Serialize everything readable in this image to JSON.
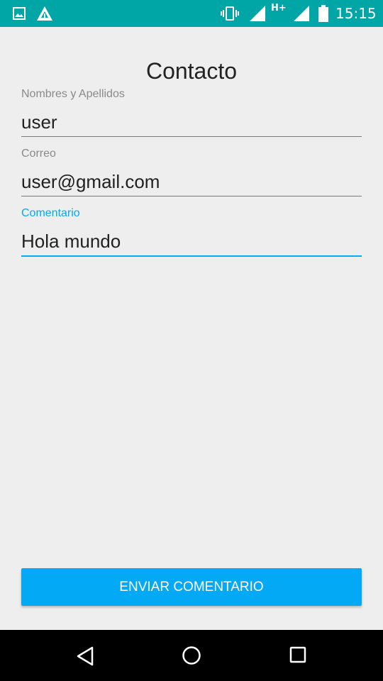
{
  "status_bar": {
    "time": "15:15",
    "network_type": "H+",
    "bg_color": "#00a6a6",
    "icons": [
      "image-icon",
      "app-notification-icon",
      "vibrate-icon",
      "signal-icon",
      "signal-icon",
      "battery-icon"
    ]
  },
  "page": {
    "title": "Contacto"
  },
  "form": {
    "name_label": "Nombres y Apellidos",
    "name_value": "user",
    "email_label": "Correo",
    "email_value": "user@gmail.com",
    "comment_label": "Comentario",
    "comment_value": "Hola mundo",
    "focused_field": "comment",
    "accent_color": "#03a9f4"
  },
  "actions": {
    "submit_label": "ENVIAR COMENTARIO"
  },
  "nav_bar": {
    "icons": [
      "back-icon",
      "home-icon",
      "recents-icon"
    ]
  }
}
